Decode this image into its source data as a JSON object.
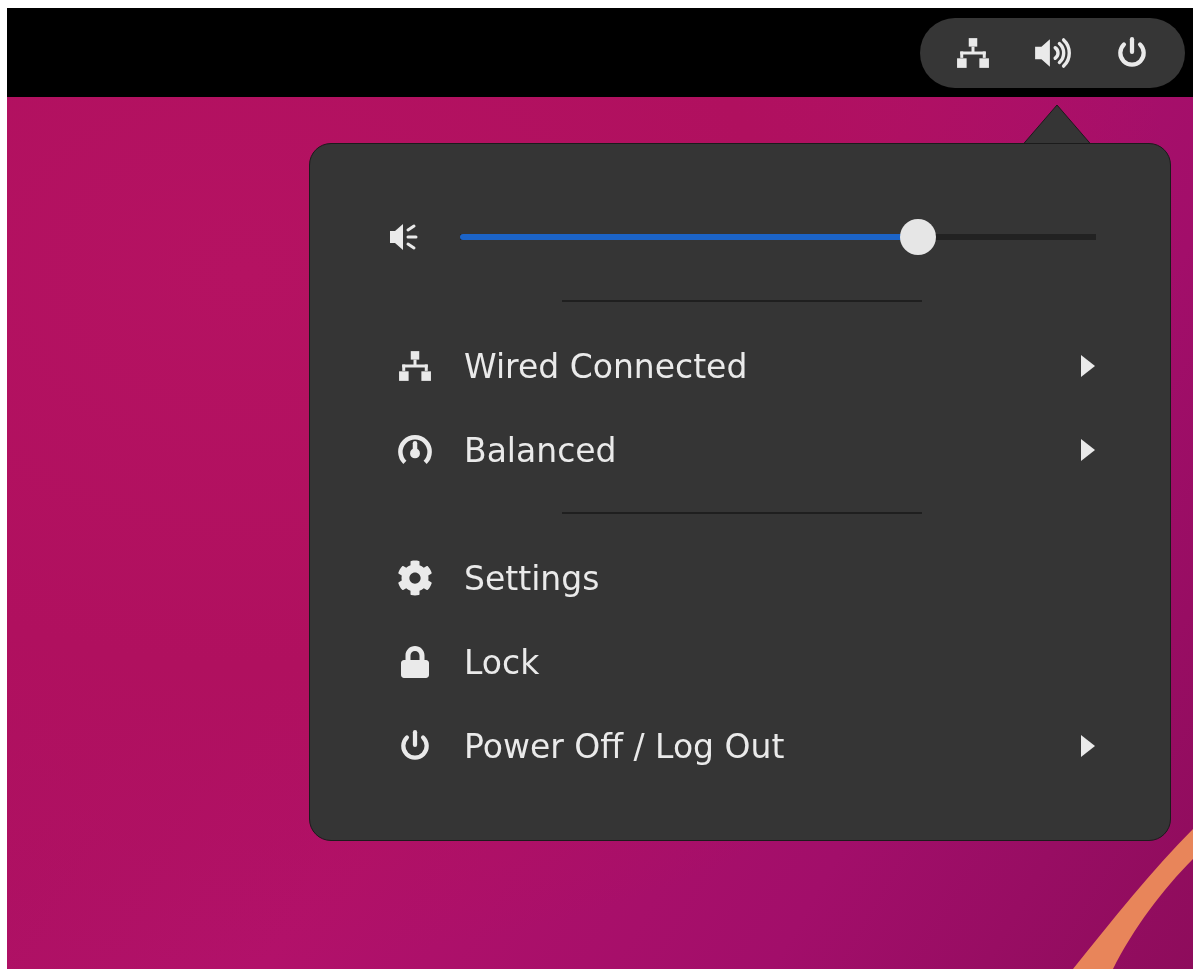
{
  "volume": {
    "level": 0.72
  },
  "sections": [
    [
      {
        "kind": "network",
        "label": "Wired Connected",
        "submenu": true
      },
      {
        "kind": "power_mode",
        "label": "Balanced",
        "submenu": true
      }
    ],
    [
      {
        "kind": "settings",
        "label": "Settings",
        "submenu": false
      },
      {
        "kind": "lock",
        "label": "Lock",
        "submenu": false
      },
      {
        "kind": "power",
        "label": "Power Off / Log Out",
        "submenu": true
      }
    ]
  ]
}
